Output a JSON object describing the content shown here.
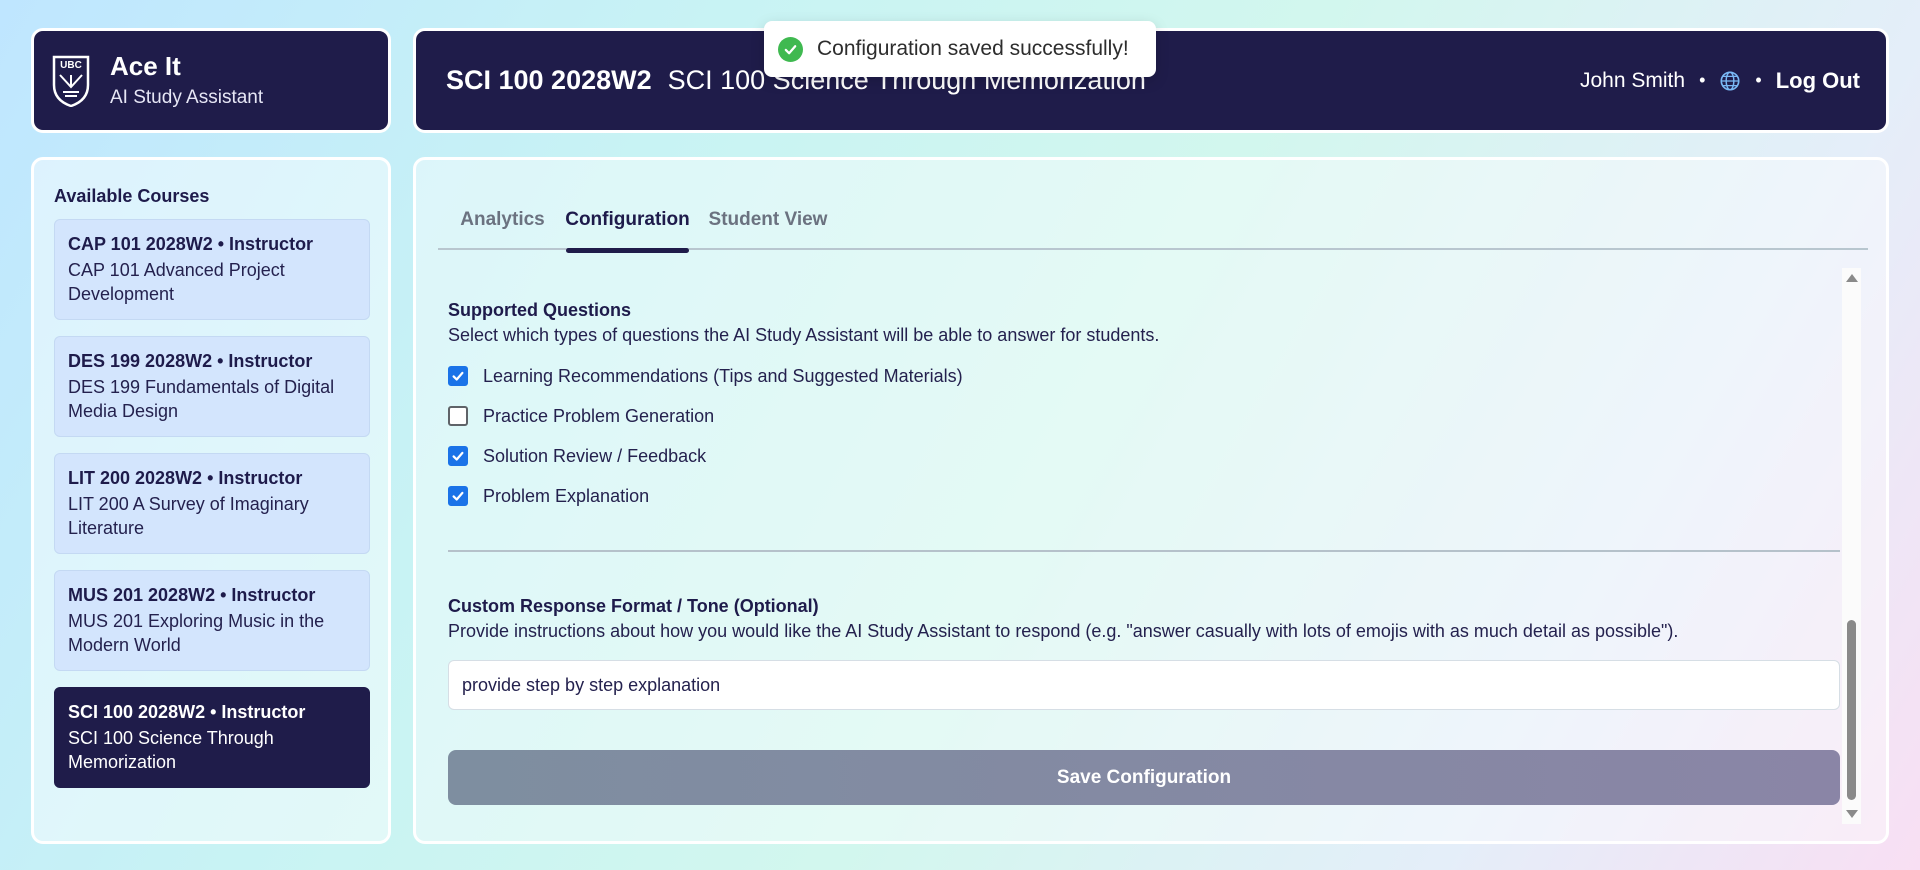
{
  "brand": {
    "logo_text": "UBC",
    "title": "Ace It",
    "subtitle": "AI Study Assistant"
  },
  "header": {
    "course_code": "SCI 100 2028W2",
    "course_name": "SCI 100 Science Through Memorization",
    "user_name": "John Smith",
    "separator": "•",
    "logout_label": "Log Out"
  },
  "toast": {
    "message": "Configuration saved successfully!"
  },
  "sidebar": {
    "heading": "Available Courses",
    "courses": [
      {
        "title": "CAP 101 2028W2 • Instructor",
        "name": "CAP 101 Advanced Project Development",
        "active": false
      },
      {
        "title": "DES 199 2028W2 • Instructor",
        "name": "DES 199 Fundamentals of Digital Media Design",
        "active": false
      },
      {
        "title": "LIT 200 2028W2 • Instructor",
        "name": "LIT 200 A Survey of Imaginary Literature",
        "active": false
      },
      {
        "title": "MUS 201 2028W2 • Instructor",
        "name": "MUS 201 Exploring Music in the Modern World",
        "active": false
      },
      {
        "title": "SCI 100 2028W2 • Instructor",
        "name": "SCI 100 Science Through Memorization",
        "active": true
      }
    ]
  },
  "tabs": [
    {
      "label": "Analytics",
      "active": false
    },
    {
      "label": "Configuration",
      "active": true
    },
    {
      "label": "Student View",
      "active": false
    }
  ],
  "supported_questions": {
    "title": "Supported Questions",
    "description": "Select which types of questions the AI Study Assistant will be able to answer for students.",
    "options": [
      {
        "label": "Learning Recommendations (Tips and Suggested Materials)",
        "checked": true
      },
      {
        "label": "Practice Problem Generation",
        "checked": false
      },
      {
        "label": "Solution Review / Feedback",
        "checked": true
      },
      {
        "label": "Problem Explanation",
        "checked": true
      }
    ]
  },
  "custom_format": {
    "title": "Custom Response Format / Tone (Optional)",
    "description": "Provide instructions about how you would like the AI Study Assistant to respond (e.g. \"answer casually with lots of emojis with as much detail as possible\").",
    "value": "provide step by step explanation"
  },
  "save_button": {
    "label": "Save Configuration"
  },
  "colors": {
    "navy": "#1f1c4a",
    "checkbox_blue": "#1a73e8",
    "success_green": "#3fb950"
  }
}
